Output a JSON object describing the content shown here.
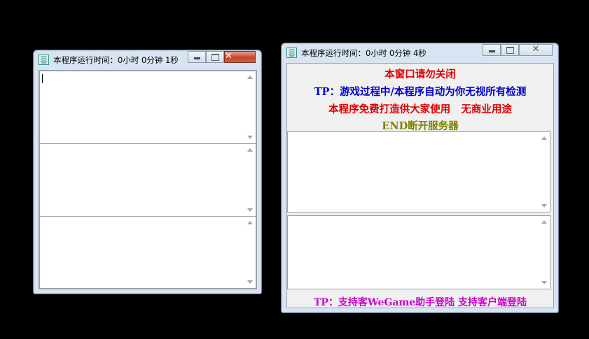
{
  "window_left": {
    "title": "本程序运行时间：0小时 0分钟 1秒",
    "close_glyph": "✕"
  },
  "window_right": {
    "title": "本程序运行时间：0小时 0分钟 4秒",
    "close_glyph": "✕",
    "notices": [
      {
        "text": "本窗口请勿关闭",
        "color": "#e00000"
      },
      {
        "text": "TP：游戏过程中/本程序自动为你无视所有检测",
        "color": "#0000cc"
      },
      {
        "text": "本程序免费打造供大家使用   无商业用途",
        "color": "#e00000"
      },
      {
        "text": "END断开服务器",
        "color": "#808000"
      }
    ],
    "footer": {
      "text": "TP：支持客WeGame助手登陆 支持客户端登陆",
      "color": "#cc00cc"
    }
  },
  "icons": [
    "app-icon",
    "minimize-icon",
    "maximize-icon",
    "close-icon",
    "scroll-up-icon",
    "scroll-down-icon"
  ]
}
